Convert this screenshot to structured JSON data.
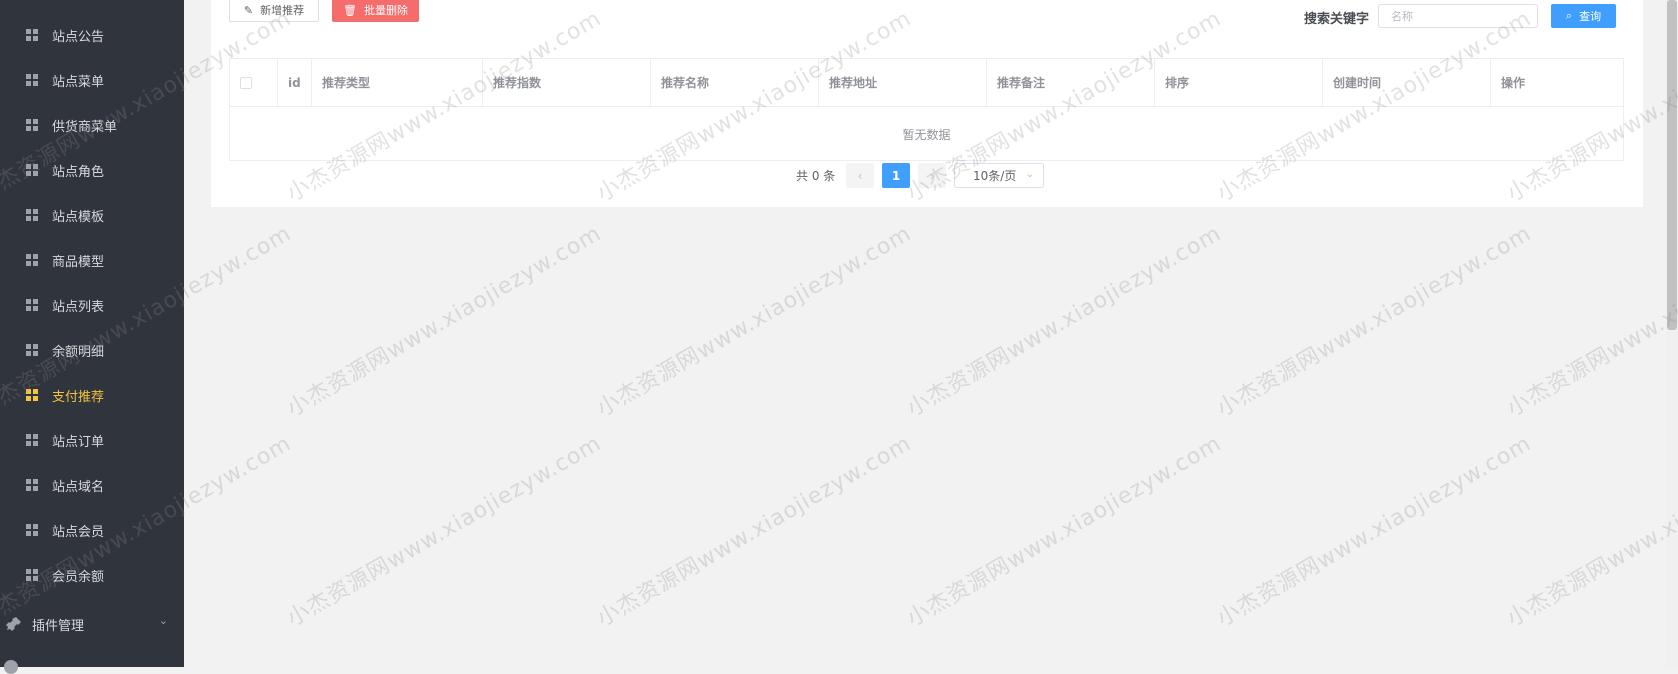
{
  "sidebar": {
    "items": [
      {
        "label": "站点公告",
        "active": false
      },
      {
        "label": "站点菜单",
        "active": false
      },
      {
        "label": "供货商菜单",
        "active": false
      },
      {
        "label": "站点角色",
        "active": false
      },
      {
        "label": "站点模板",
        "active": false
      },
      {
        "label": "商品模型",
        "active": false
      },
      {
        "label": "站点列表",
        "active": false
      },
      {
        "label": "余额明细",
        "active": false
      },
      {
        "label": "支付推荐",
        "active": true
      },
      {
        "label": "站点订单",
        "active": false
      },
      {
        "label": "站点域名",
        "active": false
      },
      {
        "label": "站点会员",
        "active": false
      },
      {
        "label": "会员余额",
        "active": false
      }
    ],
    "plugin_group": {
      "label": "插件管理",
      "icon": "plug-icon",
      "chevron": "⌄"
    },
    "active_color": "#f4c33c",
    "bg_color": "#30343d"
  },
  "toolbar": {
    "add_label": "新增推荐",
    "add_icon": "✎",
    "delete_label": "批量删除",
    "delete_icon": "🗑",
    "search_label": "搜索关键字",
    "search_placeholder": "名称",
    "query_label": "查询",
    "query_icon": "⌕"
  },
  "table": {
    "columns": [
      "id",
      "推荐类型",
      "推荐指数",
      "推荐名称",
      "推荐地址",
      "推荐备注",
      "排序",
      "创建时间",
      "操作"
    ],
    "empty_text": "暂无数据"
  },
  "pagination": {
    "total_text": "共 0 条",
    "prev": "‹",
    "current_page": "1",
    "next": "›",
    "page_size": "10条/页",
    "page_size_arrow": "⌄"
  },
  "watermark": {
    "text": "小杰资源网www.xiaojiezyw.com"
  },
  "colors": {
    "primary": "#409eff",
    "danger": "#f56c6c"
  }
}
